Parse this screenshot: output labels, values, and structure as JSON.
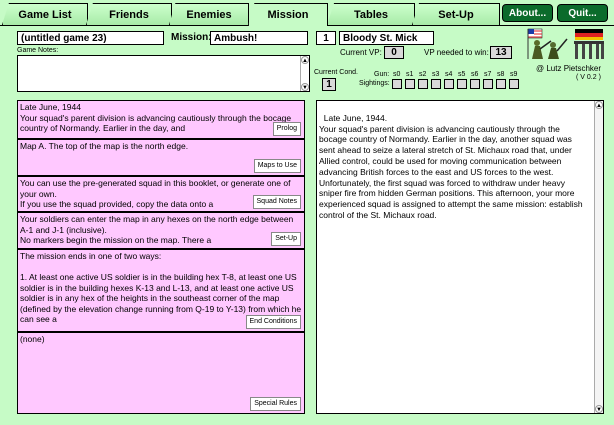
{
  "tabs": [
    "Game List",
    "Friends",
    "Enemies",
    "Mission",
    "Tables",
    "Set-Up"
  ],
  "active_tab": "Mission",
  "buttons": {
    "about": "About...",
    "quit": "Quit..."
  },
  "game_name": "(untitled game 23)",
  "mission_label": "Mission:",
  "mission_name": "Ambush!",
  "mission_number": "1",
  "mission_title": "Bloody St. Mick",
  "current_vp_label": "Current VP:",
  "current_vp": "0",
  "vp_needed_label": "VP needed to win:",
  "vp_needed": "13",
  "game_notes_label": "Game Notes:",
  "game_notes": "",
  "current_cond_label": "Current Cond.",
  "current_cond": "1",
  "gun_label": "Gun:",
  "sightings_label": "Sightings:",
  "sight_labels": [
    "s0",
    "s1",
    "s2",
    "s3",
    "s4",
    "s5",
    "s6",
    "s7",
    "s8",
    "s9"
  ],
  "credit": "@ Lutz Pietschker",
  "version": "( V 0.2 )",
  "sections": [
    {
      "text": "Late June, 1944\nYour squad's parent division is advancing cautiously through the bocage country of Normandy. Earlier in the day, and",
      "button": "Prolog"
    },
    {
      "text": "Map A. The top of the map is the north edge.",
      "button": "Maps to Use"
    },
    {
      "text": "You can use the pre-generated squad in this booklet, or generate one of your own.\nIf you use the squad provided, copy the data onto a",
      "button": "Squad Notes"
    },
    {
      "text": "Your soldiers can enter the map in any hexes on the north edge between A-1 and J-1 (inclusive).\nNo markers begin the mission on the map. There a",
      "button": "Set-Up"
    },
    {
      "text": "The mission ends in one of two ways:\n\n1. At least one active US soldier is in the building hex T-8, at least one US soldier is in the building hexes K-13 and L-13, and at least one active US soldier is in any hex of the heights in the southeast corner of the map (defined by the elevation change running from Q-19 to Y-13) from which he can see a",
      "button": "End Conditions"
    },
    {
      "text": "(none)",
      "button": "Special Rules"
    }
  ],
  "detail_text": "Late June, 1944.\nYour squad's parent division is advancing cautiously through the bocage country of Normandy. Earlier in the day, another squad was sent ahead to seize a lateral stretch of St. Michaux road that, under Allied control, could be used for moving communication between advancing British forces to the east and US forces to the west.\nUnfortunately, the first squad was forced to withdraw under heavy sniper fire from hidden German positions. This afternoon, your more experienced squad is assigned to attempt the same mission: establish control of the St. Michaux road."
}
